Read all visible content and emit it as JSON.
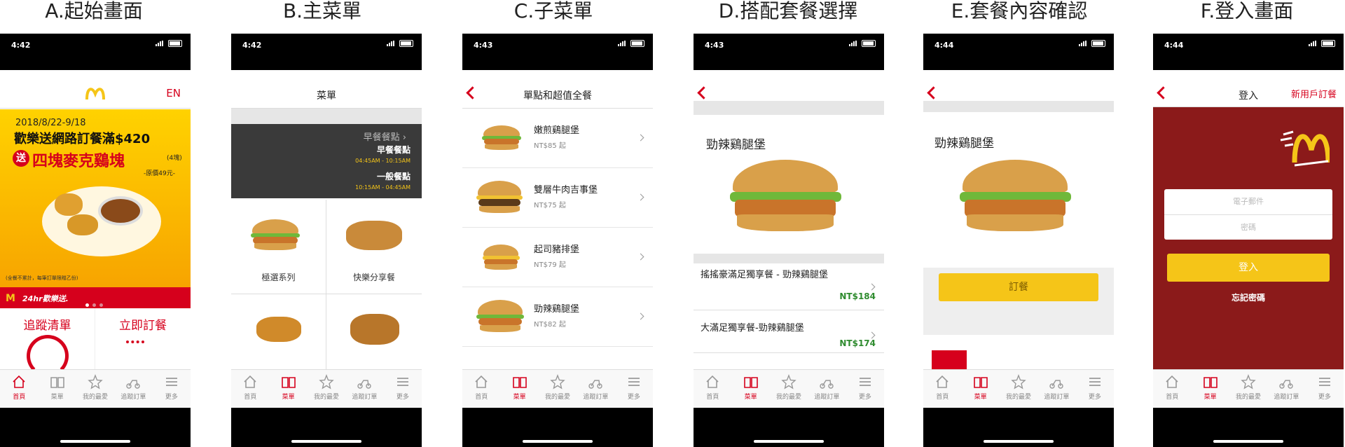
{
  "captions": [
    "A.起始畫面",
    "B.主菜單",
    "C.子菜單",
    "D.搭配套餐選擇",
    "E.套餐內容確認",
    "F.登入畫面"
  ],
  "status": {
    "t1": "4:42",
    "t2": "4:42",
    "t3": "4:43",
    "t4": "4:43",
    "t5": "4:44",
    "t6": "4:44"
  },
  "tabs": [
    "首頁",
    "菜單",
    "我的最愛",
    "追蹤訂單",
    "更多"
  ],
  "colors": {
    "brand_red": "#d6001c",
    "gold": "#f5c518",
    "maroon": "#8b1a1a",
    "price_green": "#2e8b2e"
  },
  "screenA": {
    "lang": "EN",
    "promo_date": "2018/8/22-9/18",
    "promo_line": "歡樂送網路訂餐滿$420",
    "promo_gift_badge": "送",
    "promo_gift": "四塊麥克鷄塊",
    "promo_qty": "(4塊)",
    "promo_price": "-原價49元-",
    "promo_note": "(全餐不累計，每筆訂單限贈乙份)",
    "delivery_label": "24hr歡樂送.",
    "track": "追蹤清單",
    "order": "立即訂餐"
  },
  "screenB": {
    "title": "菜單",
    "breakfast_link": "早餐餐點",
    "breakfast": "早餐餐點",
    "breakfast_time": "04:45AM - 10:15AM",
    "regular": "一般餐點",
    "regular_time": "10:15AM - 04:45AM",
    "cat1": "極選系列",
    "cat2": "快樂分享餐"
  },
  "screenC": {
    "title": "單點和超值全餐",
    "items": [
      {
        "name": "嫩煎鷄腿堡",
        "price": "NT$85 起"
      },
      {
        "name": "雙層牛肉吉事堡",
        "price": "NT$75 起"
      },
      {
        "name": "起司豬排堡",
        "price": "NT$79 起"
      },
      {
        "name": "勁辣鷄腿堡",
        "price": "NT$82 起"
      }
    ]
  },
  "screenD": {
    "product": "勁辣鷄腿堡",
    "combos": [
      {
        "name": "搖搖豪滿足獨享餐 - 勁辣鷄腿堡",
        "price": "NT$184"
      },
      {
        "name": "大滿足獨享餐-勁辣鷄腿堡",
        "price": "NT$174"
      }
    ]
  },
  "screenE": {
    "product": "勁辣鷄腿堡",
    "order_btn": "訂餐"
  },
  "screenF": {
    "title": "登入",
    "new_user": "新用戶訂餐",
    "email_ph": "電子郵件",
    "pwd_ph": "密碼",
    "login_btn": "登入",
    "forgot": "忘記密碼"
  }
}
